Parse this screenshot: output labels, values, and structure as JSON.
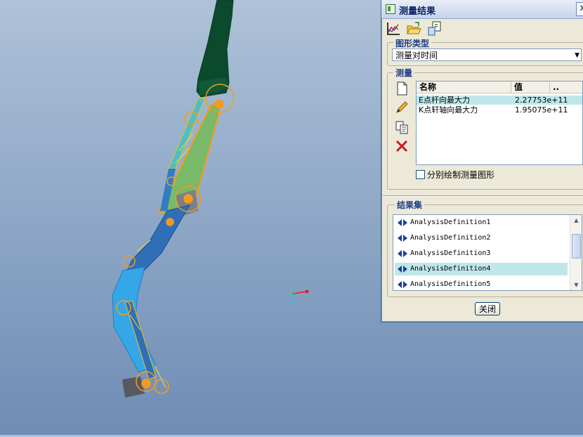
{
  "window": {
    "title": "测量结果",
    "close_glyph": "✕"
  },
  "toolbar": {
    "icons": [
      "graph-icon",
      "open-folder-icon",
      "export-icon"
    ]
  },
  "graph_type": {
    "label": "图形类型",
    "selected": "测量对时间"
  },
  "measures": {
    "label": "测量",
    "columns": [
      "名称",
      "值",
      ".."
    ],
    "rows": [
      {
        "name": "E点杆向最大力",
        "value": "2.27753e+11",
        "selected": true
      },
      {
        "name": "K点轩轴向最大力",
        "value": "1.95075e+11",
        "selected": false
      }
    ],
    "side_icons": [
      "new-document-icon",
      "edit-pencil-icon",
      "copy-icon",
      "delete-x-icon"
    ],
    "separate_plot_label": "分别绘制测量图形",
    "separate_plot_checked": false
  },
  "result_sets": {
    "label": "结果集",
    "items": [
      {
        "label": "AnalysisDefinition1",
        "selected": false
      },
      {
        "label": "AnalysisDefinition2",
        "selected": false
      },
      {
        "label": "AnalysisDefinition3",
        "selected": false
      },
      {
        "label": "AnalysisDefinition4",
        "selected": true
      },
      {
        "label": "AnalysisDefinition5",
        "selected": false
      }
    ]
  },
  "close_button": "关闭",
  "colors": {
    "background_top": "#aec2d8",
    "background_bottom": "#6f8cb4",
    "arm_dark_green": "#0c4a2e",
    "arm_blue": "#2f7ec4",
    "arm_light_blue": "#35a7e8",
    "link_green": "#79b96a",
    "highlight_orange": "#f39b1e",
    "selection": "#bfe7ea"
  }
}
